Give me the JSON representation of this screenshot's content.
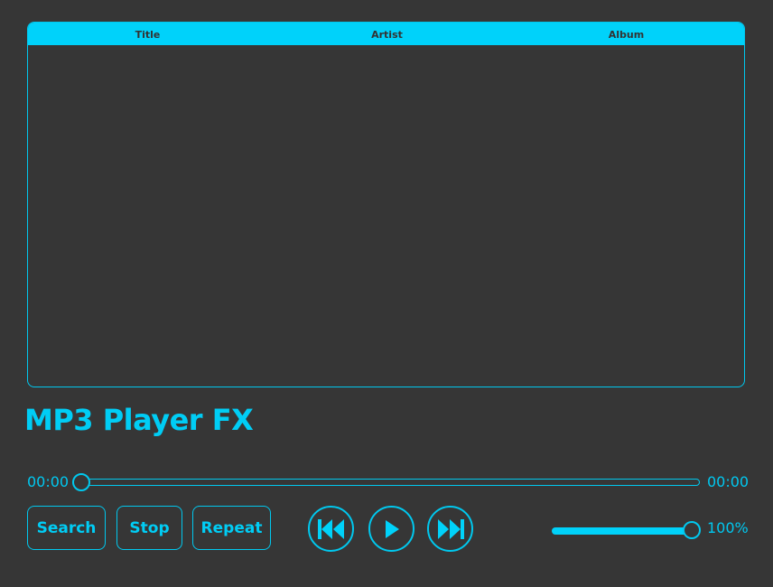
{
  "app": {
    "title": "MP3 Player FX"
  },
  "playlist": {
    "columns": [
      "Title",
      "Artist",
      "Album"
    ],
    "rows": []
  },
  "seek": {
    "current_time": "00:00",
    "total_time": "00:00",
    "progress": 0
  },
  "controls": {
    "search_label": "Search",
    "stop_label": "Stop",
    "repeat_label": "Repeat"
  },
  "volume": {
    "label": "100%",
    "level": 1.0
  },
  "theme": {
    "background": "#363636",
    "accent": "#00d2fa",
    "header_text": "#333333"
  },
  "icons": {
    "prev": "skip-previous-icon",
    "play": "play-icon",
    "next": "skip-next-icon"
  }
}
